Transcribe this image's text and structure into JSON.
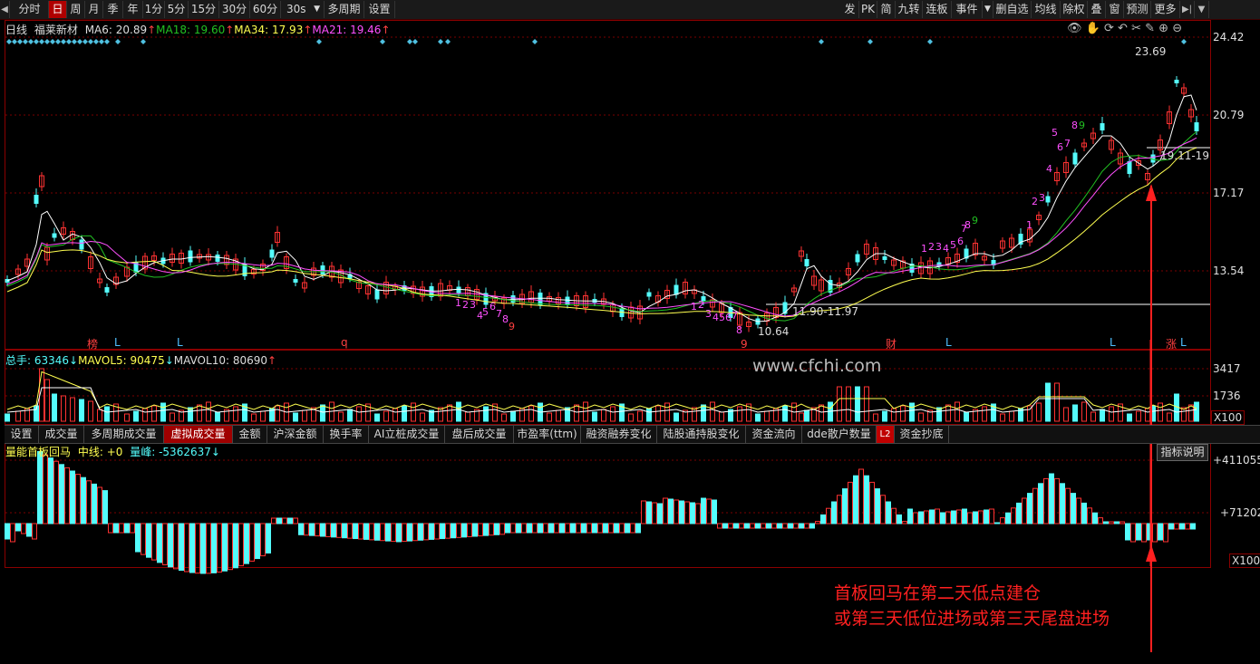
{
  "toolbar": {
    "left_items": [
      "分时",
      "日",
      "周",
      "月",
      "季",
      "年",
      "1分",
      "5分",
      "15分",
      "30分",
      "60分",
      "30s",
      "多周期",
      "设置"
    ],
    "active_index": 1,
    "right_items": [
      "发",
      "PK",
      "简",
      "九转",
      "连板",
      "事件",
      "",
      "删自选",
      "均线",
      "除权",
      "叠",
      "窗",
      "预测",
      "更多"
    ]
  },
  "kline_legend": {
    "period": "日线",
    "stock_name": "福莱新材",
    "ma6": "MA6: 20.89",
    "ma18": "MA18: 19.60",
    "ma34": "MA34: 17.93",
    "ma21": "MA21: 19.46"
  },
  "price_axis": [
    "24.42",
    "20.79",
    "17.17",
    "13.54"
  ],
  "price_annotations": {
    "high": "23.69",
    "low": "10.64",
    "range1": "11.90-11.97",
    "range2": "19.11-19"
  },
  "bottom_markers": [
    "榜",
    "L",
    "L",
    "q",
    "9",
    "财",
    "L",
    "L",
    "涨",
    "L"
  ],
  "volume_legend": {
    "total": "总手: 63346",
    "mavol5": "MAVOL5: 90475",
    "mavol10": "MAVOL10: 80690"
  },
  "volume_axis": [
    "3417",
    "1736",
    "X100"
  ],
  "watermark": "www.cfchi.com",
  "tabs": [
    "设置",
    "成交量",
    "多周期成交量",
    "虚拟成交量",
    "金额",
    "沪深金额",
    "换手率",
    "AI立桩成交量",
    "盘后成交量",
    "市盈率(ttm)",
    "融资融券变化",
    "陆股通持股变化",
    "资金流向",
    "dde散户数量",
    "L2",
    "资金抄底"
  ],
  "active_tab_index": 3,
  "indicator_legend": {
    "name": "量能首板回马",
    "midline": "中线: +0",
    "peak": "量峰: -5362637"
  },
  "indicator_axis": [
    "+411055",
    "+71202",
    "X100"
  ],
  "indicator_help": "指标说明",
  "annotation_lines": [
    "首板回马在第二天低点建仓",
    "或第三天低位进场或第三天尾盘进场"
  ],
  "colors": {
    "up": "#ff3232",
    "down": "#54fcfc",
    "ma6": "#ffffff",
    "ma18": "#22c022",
    "ma34": "#ffff50",
    "ma21": "#ff50ff",
    "arrow": "#ff2020"
  }
}
